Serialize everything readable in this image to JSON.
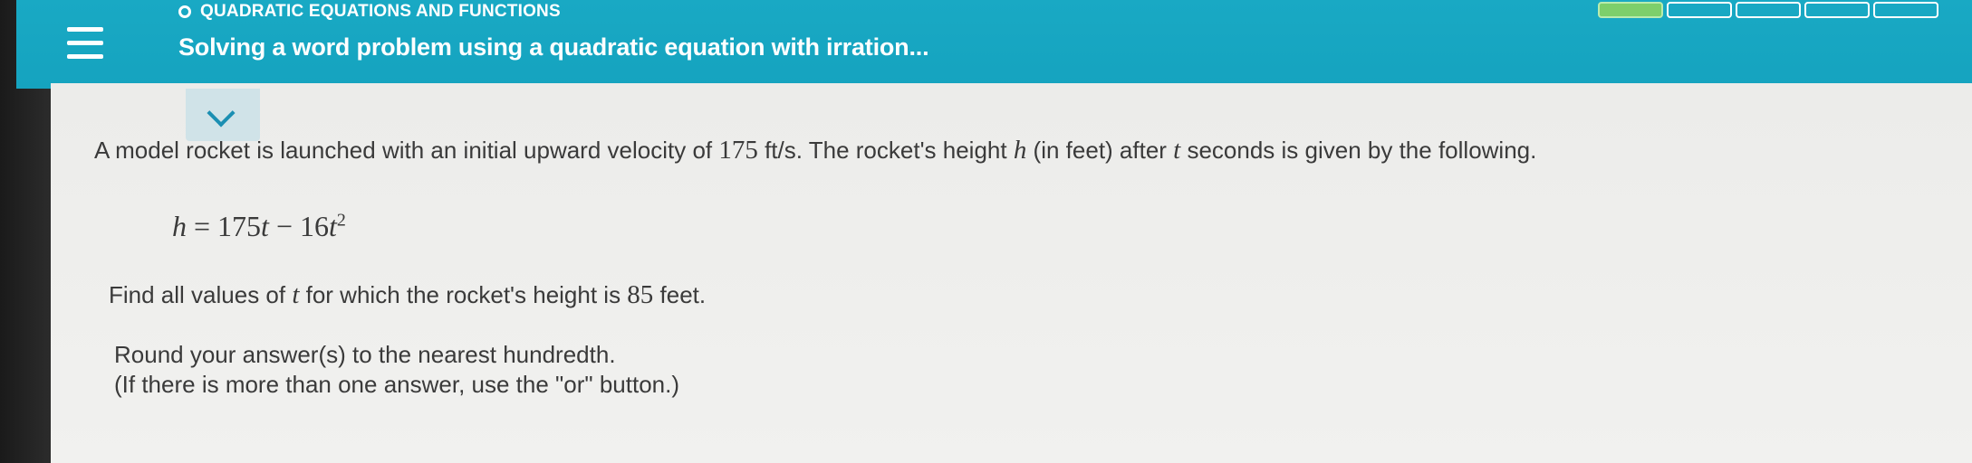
{
  "header": {
    "topic": "QUADRATIC EQUATIONS AND FUNCTIONS",
    "title": "Solving a word problem using a quadratic equation with irration..."
  },
  "progress": {
    "segments": 5,
    "filled": 1
  },
  "colors": {
    "header": "#17a6c2",
    "progress_fill": "#7dcf6b",
    "chevron": "#1b8fb2"
  },
  "problem": {
    "intro_a": "A model rocket is launched with an initial upward velocity of ",
    "velocity": "175",
    "unit": " ft/s",
    "intro_b": ". The rocket's height ",
    "var_h": "h",
    "intro_c": " (in feet) after ",
    "var_t": "t",
    "intro_d": " seconds is given by the following.",
    "equation": {
      "lhs": "h",
      "eq": " = 175",
      "t1": "t",
      "minus": " − 16",
      "t2": "t",
      "exp": "2"
    },
    "find_a": "Find all values of ",
    "find_var": "t",
    "find_b": " for which the rocket's height is ",
    "find_num": "85",
    "find_c": " feet.",
    "round_line": "Round your answer(s) to the nearest hundredth.",
    "or_line": "(If there is more than one answer, use the \"or\" button.)"
  }
}
